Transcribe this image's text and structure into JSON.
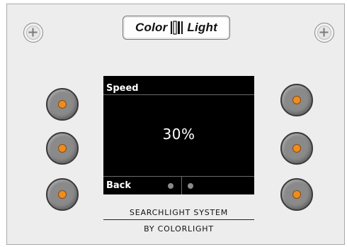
{
  "logo": {
    "left": "Color",
    "right": "Light"
  },
  "screen": {
    "title": "Speed",
    "value": "30%",
    "back_label": "Back"
  },
  "caption": {
    "line1": "SEARCHLIGHT SYSTEM",
    "line2": "BY COLORLIGHT"
  },
  "colors": {
    "panel": "#ededed",
    "button": "#8a8a8a",
    "led": "#f08c1e",
    "screen": "#000000"
  },
  "icons": [
    "screw-icon",
    "colorlight-logo-mark-icon",
    "indicator-dot-icon"
  ]
}
